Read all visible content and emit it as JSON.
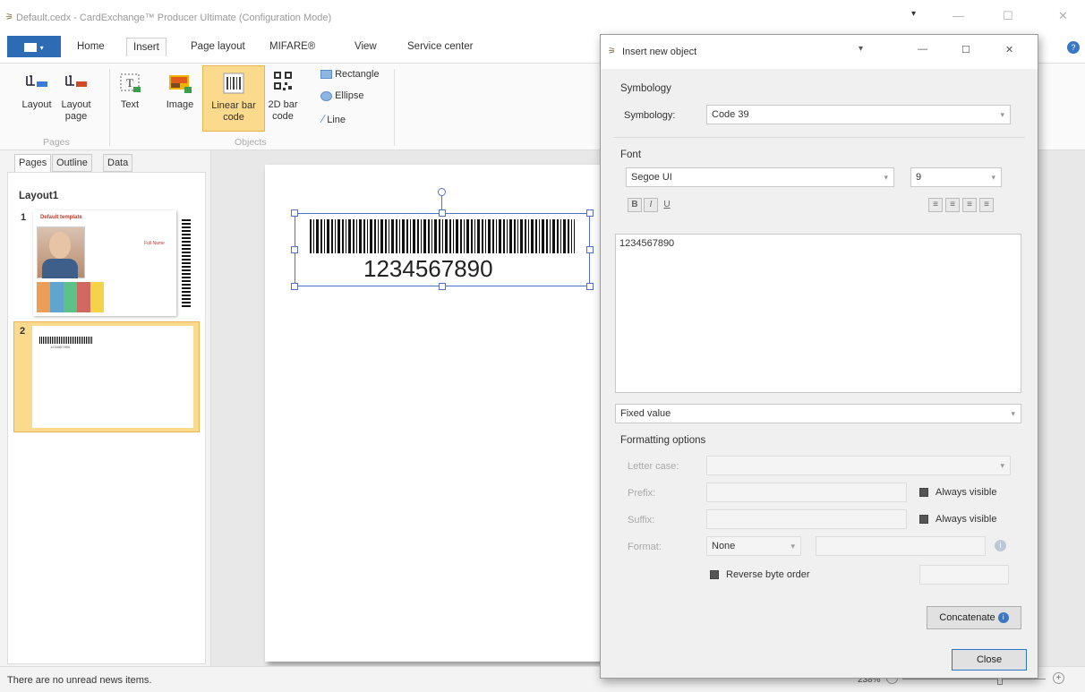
{
  "window": {
    "title": "Default.cedx - CardExchange™ Producer Ultimate (Configuration Mode)"
  },
  "ribbon_tabs": [
    "Home",
    "Insert",
    "Page layout",
    "MIFARE®",
    "View",
    "Service center"
  ],
  "ribbon": {
    "pages_group": {
      "label": "Pages",
      "layout": "Layout",
      "layout_page_line1": "Layout",
      "layout_page_line2": "page"
    },
    "objects_group": {
      "label": "Objects",
      "text": "Text",
      "image": "Image",
      "linear_line1": "Linear bar",
      "linear_line2": "code",
      "bar2d_line1": "2D bar",
      "bar2d_line2": "code",
      "rectangle": "Rectangle",
      "ellipse": "Ellipse",
      "line": "Line"
    }
  },
  "left_panel": {
    "tabs": [
      "Pages",
      "Outline",
      "Data"
    ],
    "layout_name": "Layout1",
    "page1_number": "1",
    "page1_caption": "Default template",
    "page1_name_tag": "Full Name",
    "page2_number": "2"
  },
  "canvas": {
    "barcode_text": "1234567890"
  },
  "status": {
    "message": "There are no unread news items.",
    "zoom": "238%"
  },
  "dialog": {
    "title": "Insert new object",
    "symbology_section": "Symbology",
    "symbology_label": "Symbology:",
    "symbology_value": "Code 39",
    "font_section": "Font",
    "font_name": "Segoe UI",
    "font_size": "9",
    "bold": "B",
    "italic": "I",
    "underline": "U",
    "text_value": "1234567890",
    "value_type": "Fixed value",
    "formatting_section": "Formatting options",
    "letter_case_label": "Letter case:",
    "prefix_label": "Prefix:",
    "suffix_label": "Suffix:",
    "always_visible_1": "Always visible",
    "always_visible_2": "Always visible",
    "format_label": "Format:",
    "format_value": "None",
    "reverse_byte_order": "Reverse byte order",
    "concatenate": "Concatenate",
    "close": "Close"
  }
}
